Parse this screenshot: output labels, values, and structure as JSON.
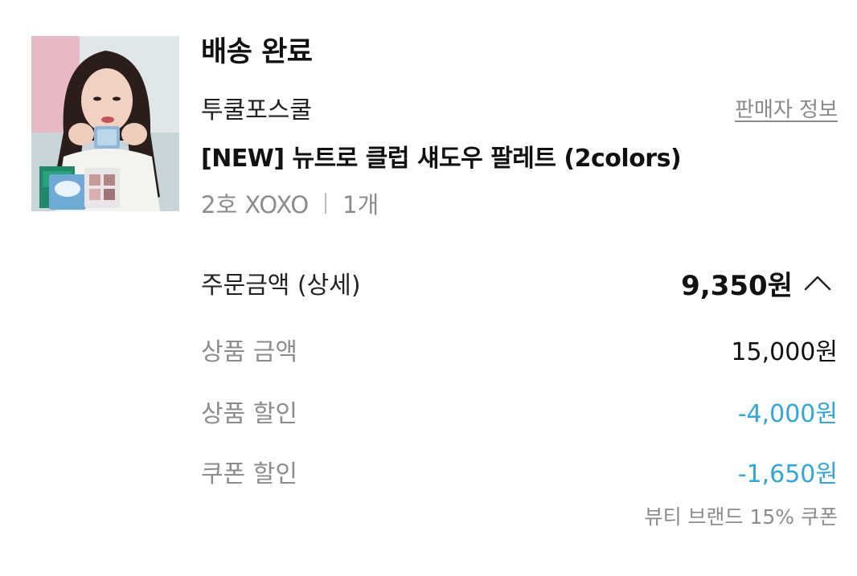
{
  "order": {
    "status": "배송 완료",
    "brand": "투쿨포스쿨",
    "seller_info_link": "판매자 정보",
    "product_name": "[NEW] 뉴트로 클럽 섀도우 팔레트 (2colors)",
    "option": "2호 XOXO",
    "quantity": "1개"
  },
  "price": {
    "total_label": "주문금액 (상세)",
    "total_value": "9,350원",
    "toggle_icon": "chevron-up-icon",
    "rows": [
      {
        "label": "상품 금액",
        "value": "15,000원"
      },
      {
        "label": "상품 할인",
        "value": "-4,000원"
      },
      {
        "label": "쿠폰 할인",
        "value": "-1,650원"
      }
    ],
    "coupon_note": "뷰티 브랜드 15% 쿠폰",
    "discount_color": "#2fa6de"
  }
}
